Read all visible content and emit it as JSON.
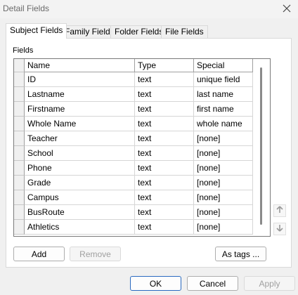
{
  "window": {
    "title": "Detail Fields"
  },
  "tabs": [
    {
      "label": "Subject Fields",
      "active": true
    },
    {
      "label": "Family Fields",
      "active": false
    },
    {
      "label": "Folder Fields",
      "active": false
    },
    {
      "label": "File Fields",
      "active": false
    }
  ],
  "fields_group": {
    "label": "Fields"
  },
  "table": {
    "columns": [
      "Name",
      "Type",
      "Special"
    ],
    "rows": [
      {
        "name": "ID",
        "type": "text",
        "special": "unique field"
      },
      {
        "name": "Lastname",
        "type": "text",
        "special": "last name"
      },
      {
        "name": "Firstname",
        "type": "text",
        "special": "first name"
      },
      {
        "name": "Whole Name",
        "type": "text",
        "special": "whole name"
      },
      {
        "name": "Teacher",
        "type": "text",
        "special": "[none]"
      },
      {
        "name": "School",
        "type": "text",
        "special": "[none]"
      },
      {
        "name": "Phone",
        "type": "text",
        "special": "[none]"
      },
      {
        "name": "Grade",
        "type": "text",
        "special": "[none]"
      },
      {
        "name": "Campus",
        "type": "text",
        "special": "[none]"
      },
      {
        "name": "BusRoute",
        "type": "text",
        "special": "[none]"
      },
      {
        "name": "Athletics",
        "type": "text",
        "special": "[none]"
      }
    ]
  },
  "buttons": {
    "add": "Add",
    "remove": "Remove",
    "as_tags": "As tags ...",
    "ok": "OK",
    "cancel": "Cancel",
    "apply": "Apply"
  },
  "icons": {
    "close": "close-icon",
    "move_up": "arrow-up-icon",
    "move_down": "arrow-down-icon"
  }
}
